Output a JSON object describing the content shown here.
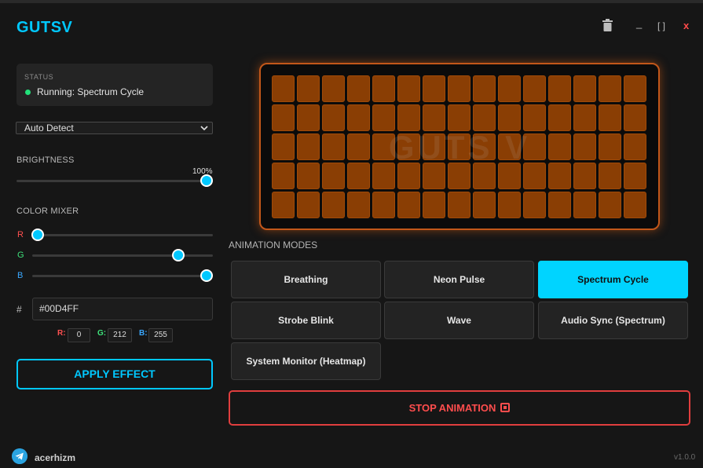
{
  "app": {
    "title": "GUTSV",
    "version": "v1.0.0",
    "author": "acerhizm"
  },
  "window_controls": {
    "minimize": "_",
    "maximize": "[ ]",
    "close": "x"
  },
  "status": {
    "label": "STATUS",
    "text": "Running: Spectrum Cycle",
    "dot_color": "#22e07a"
  },
  "device_select": {
    "value": "Auto Detect"
  },
  "brightness": {
    "label": "BRIGHTNESS",
    "value_text": "100%",
    "value": 100
  },
  "color_mixer": {
    "label": "COLOR MIXER",
    "channels": [
      {
        "name": "R",
        "value": 0,
        "color": "#ff5050"
      },
      {
        "name": "G",
        "value": 212,
        "color": "#3ee07a"
      },
      {
        "name": "B",
        "value": 255,
        "color": "#3aa8ff"
      }
    ],
    "hash_symbol": "#",
    "hex": "#00D4FF",
    "readout": {
      "r_label": "R:",
      "r_value": "0",
      "g_label": "G:",
      "g_value": "212",
      "b_label": "B:",
      "b_value": "255"
    }
  },
  "apply_button": "APPLY EFFECT",
  "keyboard_preview": {
    "watermark": "GUTS V",
    "rows": 5,
    "cols": 15,
    "key_color": "#8a3e04",
    "glow_color": "#c2571a"
  },
  "animation_modes": {
    "label": "ANIMATION MODES",
    "modes": [
      {
        "label": "Breathing",
        "active": false
      },
      {
        "label": "Neon Pulse",
        "active": false
      },
      {
        "label": "Spectrum Cycle",
        "active": true
      },
      {
        "label": "Strobe Blink",
        "active": false
      },
      {
        "label": "Wave",
        "active": false
      },
      {
        "label": "Audio Sync (Spectrum)",
        "active": false
      },
      {
        "label": "System Monitor (Heatmap)",
        "active": false
      }
    ]
  },
  "stop_button": "STOP ANIMATION",
  "accent_color": "#00c8ff",
  "danger_color": "#e03e3e"
}
